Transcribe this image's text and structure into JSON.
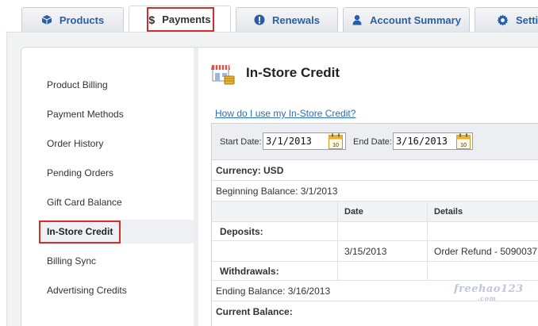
{
  "tabs": [
    {
      "label": "Products",
      "icon": "cube-icon"
    },
    {
      "label": "Payments",
      "icon": "dollar-icon",
      "active": true
    },
    {
      "label": "Renewals",
      "icon": "alert-icon"
    },
    {
      "label": "Account Summary",
      "icon": "user-icon"
    },
    {
      "label": "Setti",
      "icon": "gear-icon"
    }
  ],
  "sidebar": {
    "items": [
      {
        "label": "Product Billing"
      },
      {
        "label": "Payment Methods"
      },
      {
        "label": "Order History"
      },
      {
        "label": "Pending Orders"
      },
      {
        "label": "Gift Card Balance"
      },
      {
        "label": "In-Store Credit",
        "active": true
      },
      {
        "label": "Billing Sync"
      },
      {
        "label": "Advertising Credits"
      }
    ]
  },
  "main": {
    "title": "In-Store Credit",
    "help_link": "How do I use my In-Store Credit?",
    "filter": {
      "start_label": "Start Date:",
      "start_value": "3/1/2013",
      "end_label": "End Date:",
      "end_value": "3/16/2013",
      "cal_day": "10"
    },
    "currency": "Currency: USD",
    "beginning_balance": "Beginning Balance: 3/1/2013",
    "columns": {
      "date": "Date",
      "details": "Details"
    },
    "deposits_label": "Deposits:",
    "deposit_row": {
      "date": "3/15/2013",
      "details": "Order Refund - 5090037"
    },
    "withdrawals_label": "Withdrawals:",
    "ending_balance": "Ending Balance: 3/16/2013",
    "current_balance": "Current Balance:"
  },
  "watermark": {
    "main": "freehao123",
    "sub": ".com"
  },
  "colors": {
    "link": "#2a6cc0",
    "tab_text": "#2a5ea8",
    "highlight": "#d12d2d"
  }
}
